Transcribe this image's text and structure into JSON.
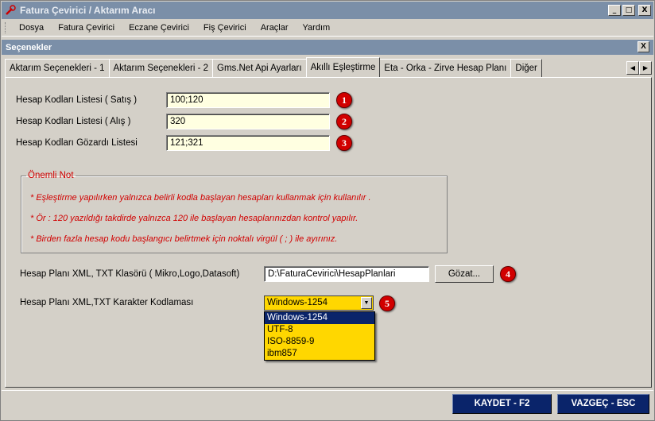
{
  "window": {
    "title": "Fatura Çevirici / Aktarım Aracı",
    "buttons": {
      "minimize": "_",
      "maximize": "□",
      "close": "X"
    }
  },
  "menu": [
    "Dosya",
    "Fatura Çevirici",
    "Eczane Çevirici",
    "Fiş Çevirici",
    "Araçlar",
    "Yardım"
  ],
  "panel": {
    "title": "Seçenekler",
    "close": "X"
  },
  "tabs": [
    "Aktarım Seçenekleri - 1",
    "Aktarım Seçenekleri - 2",
    "Gms.Net Api Ayarları",
    "Akıllı Eşleştirme",
    "Eta - Orka - Zirve Hesap Planı",
    "Diğer"
  ],
  "active_tab": "Akıllı Eşleştirme",
  "form": {
    "satis_label": "Hesap Kodları Listesi ( Satış )",
    "satis_value": "100;120",
    "alis_label": "Hesap Kodları Listesi ( Alış )",
    "alis_value": "320",
    "gozardi_label": "Hesap Kodları Gözardı Listesi",
    "gozardi_value": "121;321",
    "badges": [
      "1",
      "2",
      "3",
      "4",
      "5"
    ]
  },
  "note": {
    "legend": "Önemli Not",
    "lines": [
      "* Eşleştirme yapılırken yalnızca belirli kodla başlayan hesapları kullanmak için kullanılır .",
      "* Ör : 120 yazıldığı takdirde yalnızca 120 ile başlayan hesaplarınızdan kontrol yapılır.",
      "* Birden fazla hesap kodu başlangıcı belirtmek için noktalı virgül ( ; ) ile ayırınız."
    ]
  },
  "xml_folder": {
    "label": "Hesap Planı XML, TXT Klasörü ( Mikro,Logo,Datasoft)",
    "value": "D:\\FaturaCevirici\\HesapPlanlari",
    "browse_label": "Gözat..."
  },
  "encoding": {
    "label": "Hesap Planı XML,TXT Karakter Kodlaması",
    "selected": "Windows-1254",
    "options": [
      "Windows-1254",
      "UTF-8",
      "ISO-8859-9",
      "ibm857"
    ]
  },
  "footer": {
    "save": "KAYDET - F2",
    "cancel": "VAZGEÇ - ESC"
  },
  "colors": {
    "title_bar": "#7b8fa8",
    "input_bg": "#ffffe1",
    "combo_bg": "#ffd700",
    "badge": "#d10000",
    "footer_btn": "#0a246a"
  }
}
